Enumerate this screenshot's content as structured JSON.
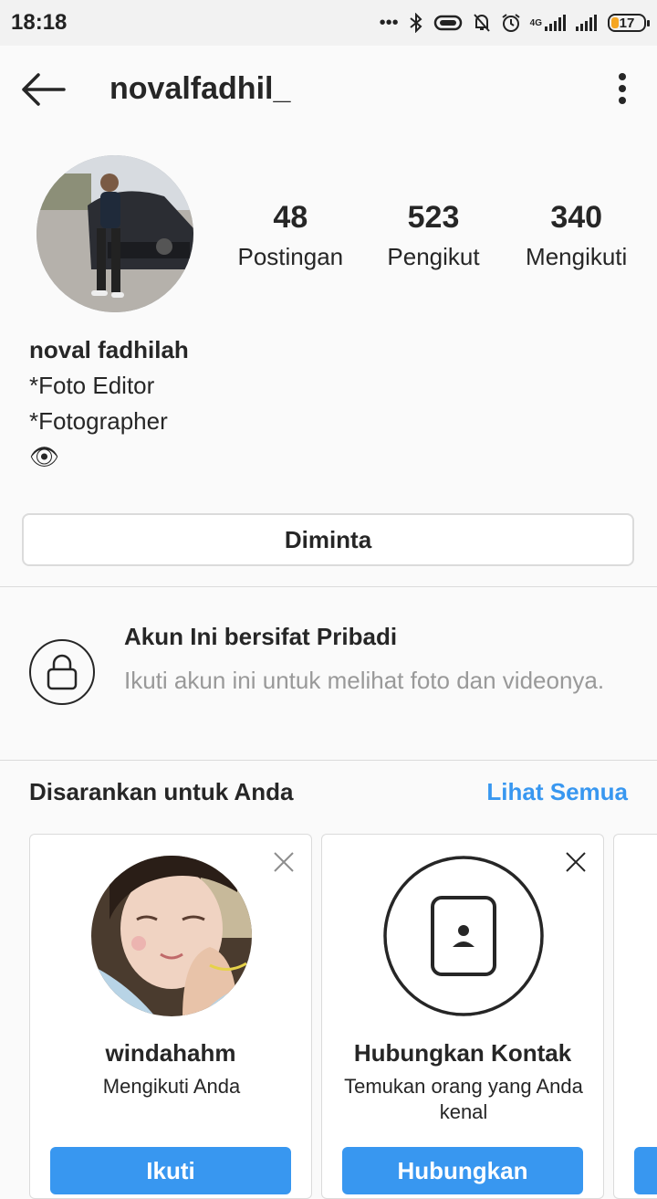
{
  "status_bar": {
    "time": "18:18",
    "network": "4G",
    "battery": "17"
  },
  "header": {
    "username": "novalfadhil_"
  },
  "profile": {
    "stats": [
      {
        "value": "48",
        "label": "Postingan"
      },
      {
        "value": "523",
        "label": "Pengikut"
      },
      {
        "value": "340",
        "label": "Mengikuti"
      }
    ],
    "bio": {
      "name": "noval fadhilah",
      "line1": "*Foto Editor",
      "line2": "*Fotographer",
      "line3": "👁"
    },
    "action_button": "Diminta"
  },
  "private": {
    "title": "Akun Ini bersifat Pribadi",
    "description": "Ikuti akun ini untuk melihat foto dan videonya."
  },
  "suggestions": {
    "heading": "Disarankan untuk Anda",
    "see_all": "Lihat Semua",
    "cards": [
      {
        "title": "windahahm",
        "subtitle": "Mengikuti Anda",
        "cta": "Ikuti"
      },
      {
        "title": "Hubungkan Kontak",
        "subtitle": "Temukan orang yang Anda kenal",
        "cta": "Hubungkan"
      }
    ]
  },
  "colors": {
    "accent": "#3897f0",
    "text": "#262626",
    "muted": "#999999",
    "border": "#dbdbdb"
  }
}
